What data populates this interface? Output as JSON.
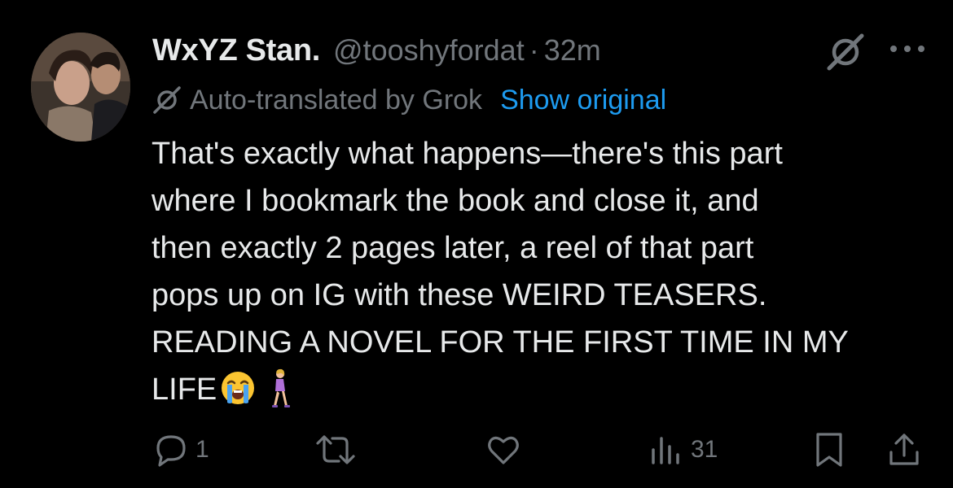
{
  "tweet": {
    "display_name": "WxYZ Stan.",
    "handle": "@tooshyfordat",
    "separator": "·",
    "timestamp": "32m",
    "translation_notice": "Auto-translated by Grok",
    "show_original_label": "Show original",
    "body_lines": [
      "That's exactly what happens—there's this part",
      "where I bookmark the book and close it, and",
      "then exactly 2 pages later, a reel of that part",
      "pops up on IG with these WEIRD TEASERS.",
      "READING A NOVEL FOR THE FIRST TIME IN MY",
      "LIFE"
    ],
    "emojis": [
      "loudly-crying-face",
      "woman-walking"
    ]
  },
  "actions": {
    "reply_count": "1",
    "retweet_count": "",
    "like_count": "",
    "views_count": "31"
  },
  "icons": {
    "top_right": [
      "grok-icon",
      "more-options-icon"
    ],
    "action_bar": [
      "reply-icon",
      "retweet-icon",
      "like-icon",
      "views-icon",
      "bookmark-icon",
      "share-icon"
    ]
  },
  "colors": {
    "background": "#000000",
    "text_primary": "#e7e9ea",
    "text_secondary": "#71767b",
    "link": "#1d9bf0"
  }
}
